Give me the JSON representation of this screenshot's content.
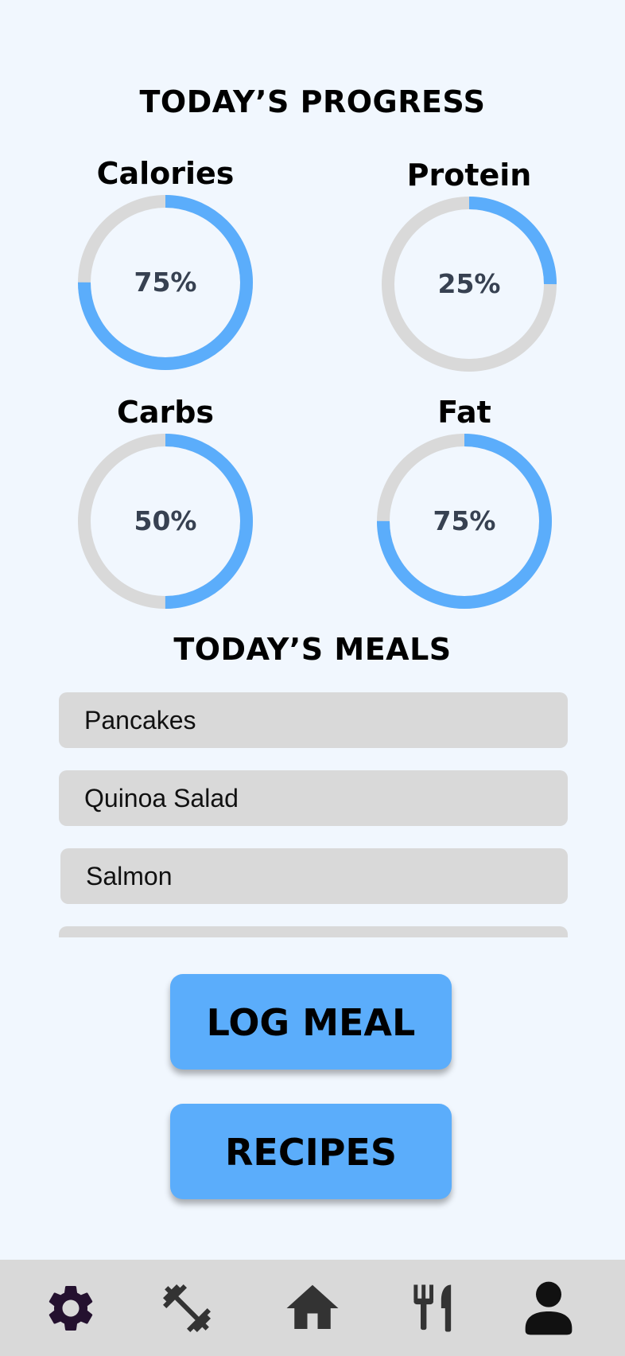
{
  "progress": {
    "title": "TODAY’S PROGRESS",
    "rings": [
      {
        "label": "Calories",
        "percent_text": "75%",
        "value": 0.75
      },
      {
        "label": "Protein",
        "percent_text": "25%",
        "value": 0.25
      },
      {
        "label": "Carbs",
        "percent_text": "50%",
        "value": 0.5
      },
      {
        "label": "Fat",
        "percent_text": "75%",
        "value": 0.75
      }
    ]
  },
  "meals": {
    "title": "TODAY’S MEALS",
    "items": [
      "Pancakes",
      "Quinoa Salad",
      "Salmon",
      ""
    ]
  },
  "actions": {
    "log_meal": "LOG MEAL",
    "recipes": "RECIPES"
  },
  "nav": {
    "items": [
      {
        "icon": "gear-icon",
        "name": "settings"
      },
      {
        "icon": "dumbbell-icon",
        "name": "workouts"
      },
      {
        "icon": "home-icon",
        "name": "home"
      },
      {
        "icon": "fork-knife-icon",
        "name": "meals"
      },
      {
        "icon": "person-icon",
        "name": "profile"
      }
    ]
  },
  "colors": {
    "background": "#f1f7fe",
    "accent": "#5badfb",
    "track": "#d9d9d9",
    "settings_icon": "#24112f",
    "nav_icon": "#333333"
  }
}
